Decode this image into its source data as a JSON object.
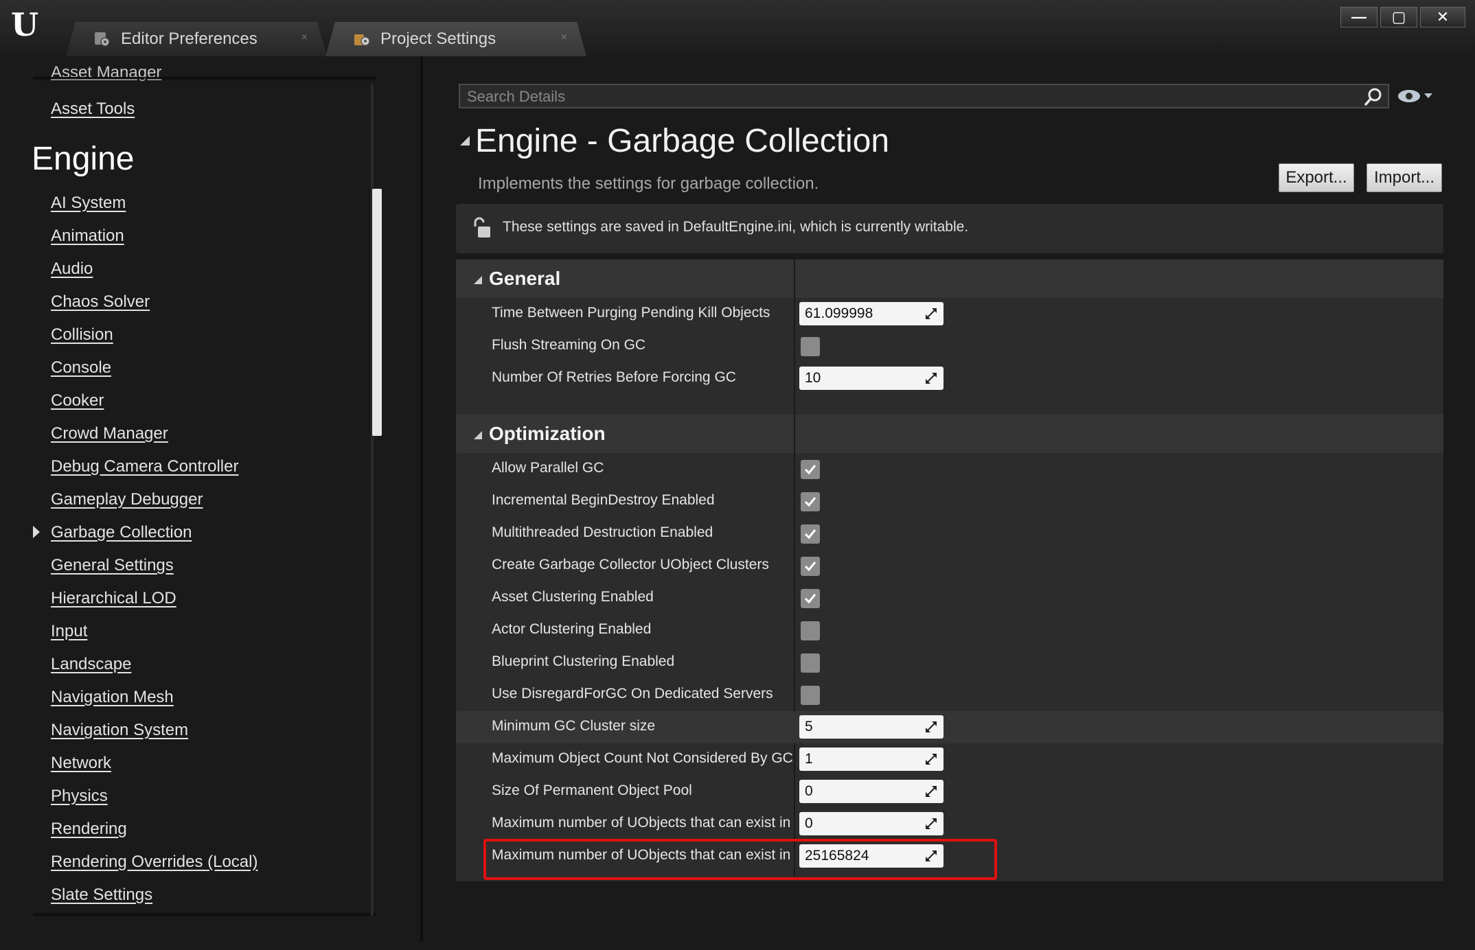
{
  "window": {
    "logo_text": "U",
    "tabs": [
      {
        "label": "Editor Preferences",
        "close": "×"
      },
      {
        "label": "Project Settings",
        "close": "×"
      }
    ],
    "minimize_glyph": "—",
    "maximize_glyph": "▢",
    "close_glyph": "✕"
  },
  "sidebar": {
    "cut_item": "Asset Manager",
    "pre_items": [
      "Asset Tools"
    ],
    "section_title": "Engine",
    "items": [
      "AI System",
      "Animation",
      "Audio",
      "Chaos Solver",
      "Collision",
      "Console",
      "Cooker",
      "Crowd Manager",
      "Debug Camera Controller",
      "Gameplay Debugger",
      "Garbage Collection",
      "General Settings",
      "Hierarchical LOD",
      "Input",
      "Landscape",
      "Navigation Mesh",
      "Navigation System",
      "Network",
      "Physics",
      "Rendering",
      "Rendering Overrides (Local)",
      "Slate Settings"
    ],
    "selected_item": "Garbage Collection"
  },
  "details": {
    "search_placeholder": "Search Details",
    "title": "Engine - Garbage Collection",
    "description": "Implements the settings for garbage collection.",
    "export_label": "Export...",
    "import_label": "Import...",
    "notice": "These settings are saved in DefaultEngine.ini, which is currently writable."
  },
  "categories": [
    {
      "title": "General",
      "rows": [
        {
          "label": "Time Between Purging Pending Kill Objects",
          "type": "number",
          "value": "61.099998"
        },
        {
          "label": "Flush Streaming On GC",
          "type": "checkbox",
          "checked": false
        },
        {
          "label": "Number Of Retries Before Forcing GC",
          "type": "number",
          "value": "10"
        }
      ]
    },
    {
      "title": "Optimization",
      "rows": [
        {
          "label": "Allow Parallel GC",
          "type": "checkbox",
          "checked": true
        },
        {
          "label": "Incremental BeginDestroy Enabled",
          "type": "checkbox",
          "checked": true
        },
        {
          "label": "Multithreaded Destruction Enabled",
          "type": "checkbox",
          "checked": true
        },
        {
          "label": "Create Garbage Collector UObject Clusters",
          "type": "checkbox",
          "checked": true
        },
        {
          "label": "Asset Clustering Enabled",
          "type": "checkbox",
          "checked": true
        },
        {
          "label": "Actor Clustering Enabled",
          "type": "checkbox",
          "checked": false
        },
        {
          "label": "Blueprint Clustering Enabled",
          "type": "checkbox",
          "checked": false
        },
        {
          "label": "Use DisregardForGC On Dedicated Servers",
          "type": "checkbox",
          "checked": false
        },
        {
          "label": "Minimum GC Cluster size",
          "type": "number",
          "value": "5"
        },
        {
          "label": "Maximum Object Count Not Considered By GC",
          "type": "number",
          "value": "1"
        },
        {
          "label": "Size Of Permanent Object Pool",
          "type": "number",
          "value": "0"
        },
        {
          "label": "Maximum number of UObjects that can exist in",
          "type": "number",
          "value": "0"
        },
        {
          "label": "Maximum number of UObjects that can exist in",
          "type": "number",
          "value": "25165824"
        }
      ]
    }
  ],
  "colors": {
    "highlight_outline": "#e01010",
    "checkbox": "#8a8a8a",
    "checkmark": "#ffffff"
  }
}
